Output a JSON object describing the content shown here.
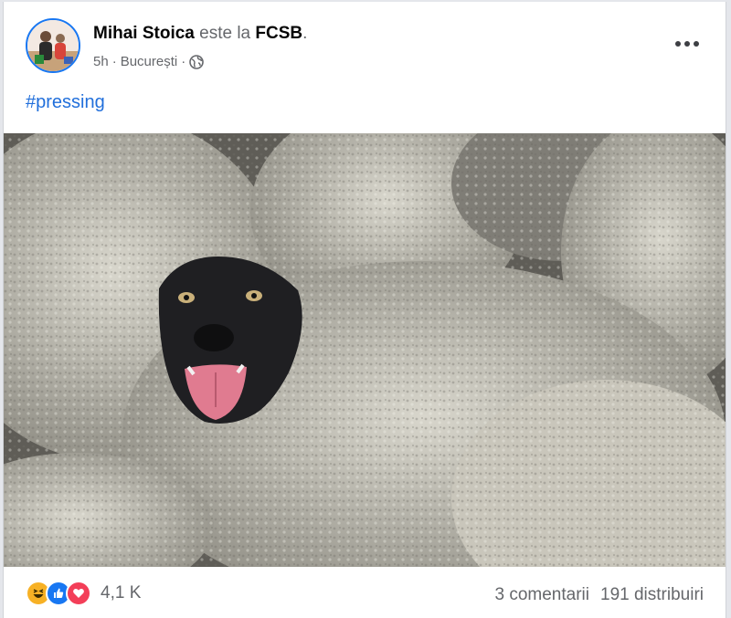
{
  "post": {
    "author": "Mihai Stoica",
    "connector": "este la",
    "group": "FCSB",
    "group_suffix": ".",
    "time": "5h",
    "location": "București",
    "separator": "·",
    "privacy_icon": "globe-icon",
    "hashtag": "#pressing",
    "photo_alt": "dog-among-sheep-photo"
  },
  "footer": {
    "reaction_icons": [
      "haha-icon",
      "like-icon",
      "love-icon"
    ],
    "reaction_count": "4,1 K",
    "comments": "3 comentarii",
    "shares": "191 distribuiri"
  },
  "colors": {
    "link": "#216fdb",
    "like": "#1877f2",
    "love": "#f33e58",
    "haha": "#f7b125"
  }
}
